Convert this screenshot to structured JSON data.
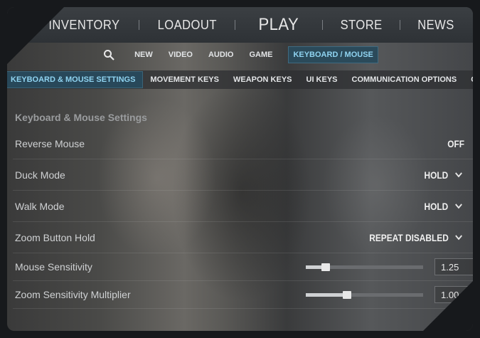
{
  "top_nav": {
    "items": [
      {
        "label": "INVENTORY"
      },
      {
        "label": "LOADOUT"
      },
      {
        "label": "PLAY"
      },
      {
        "label": "STORE"
      },
      {
        "label": "NEWS"
      }
    ]
  },
  "sub_nav": {
    "search_icon": "search-icon",
    "tabs": [
      {
        "label": "NEW"
      },
      {
        "label": "VIDEO"
      },
      {
        "label": "AUDIO"
      },
      {
        "label": "GAME"
      },
      {
        "label": "KEYBOARD / MOUSE",
        "active": true
      }
    ]
  },
  "settings_tabs": [
    {
      "label": "KEYBOARD & MOUSE SETTINGS",
      "active": true
    },
    {
      "label": "MOVEMENT KEYS"
    },
    {
      "label": "WEAPON KEYS"
    },
    {
      "label": "UI KEYS"
    },
    {
      "label": "COMMUNICATION OPTIONS"
    },
    {
      "label": "CHAT WHEEL KE"
    }
  ],
  "section": {
    "title": "Keyboard & Mouse Settings",
    "rows": [
      {
        "label": "Reverse Mouse",
        "value": "OFF"
      },
      {
        "label": "Duck Mode",
        "value": "HOLD"
      },
      {
        "label": "Walk Mode",
        "value": "HOLD"
      },
      {
        "label": "Zoom Button Hold",
        "value": "REPEAT DISABLED"
      },
      {
        "label": "Mouse Sensitivity",
        "value": "1.25",
        "slider_level": 0.17
      },
      {
        "label": "Zoom Sensitivity Multiplier",
        "value": "1.00",
        "slider_level": 0.35
      }
    ]
  },
  "colors": {
    "accent": "#8fd3f0",
    "active_tab_bg": "#28485a"
  }
}
